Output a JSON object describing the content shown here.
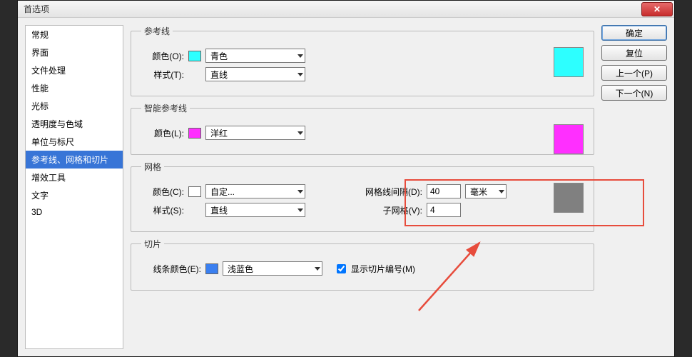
{
  "window": {
    "title": "首选项"
  },
  "sidebar": {
    "items": [
      {
        "label": "常规"
      },
      {
        "label": "界面"
      },
      {
        "label": "文件处理"
      },
      {
        "label": "性能"
      },
      {
        "label": "光标"
      },
      {
        "label": "透明度与色域"
      },
      {
        "label": "单位与标尺"
      },
      {
        "label": "参考线、网格和切片"
      },
      {
        "label": "增效工具"
      },
      {
        "label": "文字"
      },
      {
        "label": "3D"
      }
    ],
    "selected_index": 7
  },
  "buttons": {
    "ok": "确定",
    "reset": "复位",
    "prev": "上一个(P)",
    "next": "下一个(N)"
  },
  "guides": {
    "legend": "参考线",
    "color_label": "颜色(O):",
    "color_value": "青色",
    "color_hex": "#2dffff",
    "style_label": "样式(T):",
    "style_value": "直线"
  },
  "smart_guides": {
    "legend": "智能参考线",
    "color_label": "颜色(L):",
    "color_value": "洋红",
    "color_hex": "#ff2fff"
  },
  "grid": {
    "legend": "网格",
    "color_label": "颜色(C):",
    "color_value": "自定...",
    "color_hex": "#808080",
    "style_label": "样式(S):",
    "style_value": "直线",
    "spacing_label": "网格线间隔(D):",
    "spacing_value": "40",
    "spacing_unit": "毫米",
    "subdiv_label": "子网格(V):",
    "subdiv_value": "4"
  },
  "slices": {
    "legend": "切片",
    "color_label": "线条颜色(E):",
    "color_value": "浅蓝色",
    "color_hex": "#3a7ff0",
    "checkbox_label": "显示切片编号(M)",
    "checkbox_checked": true
  }
}
